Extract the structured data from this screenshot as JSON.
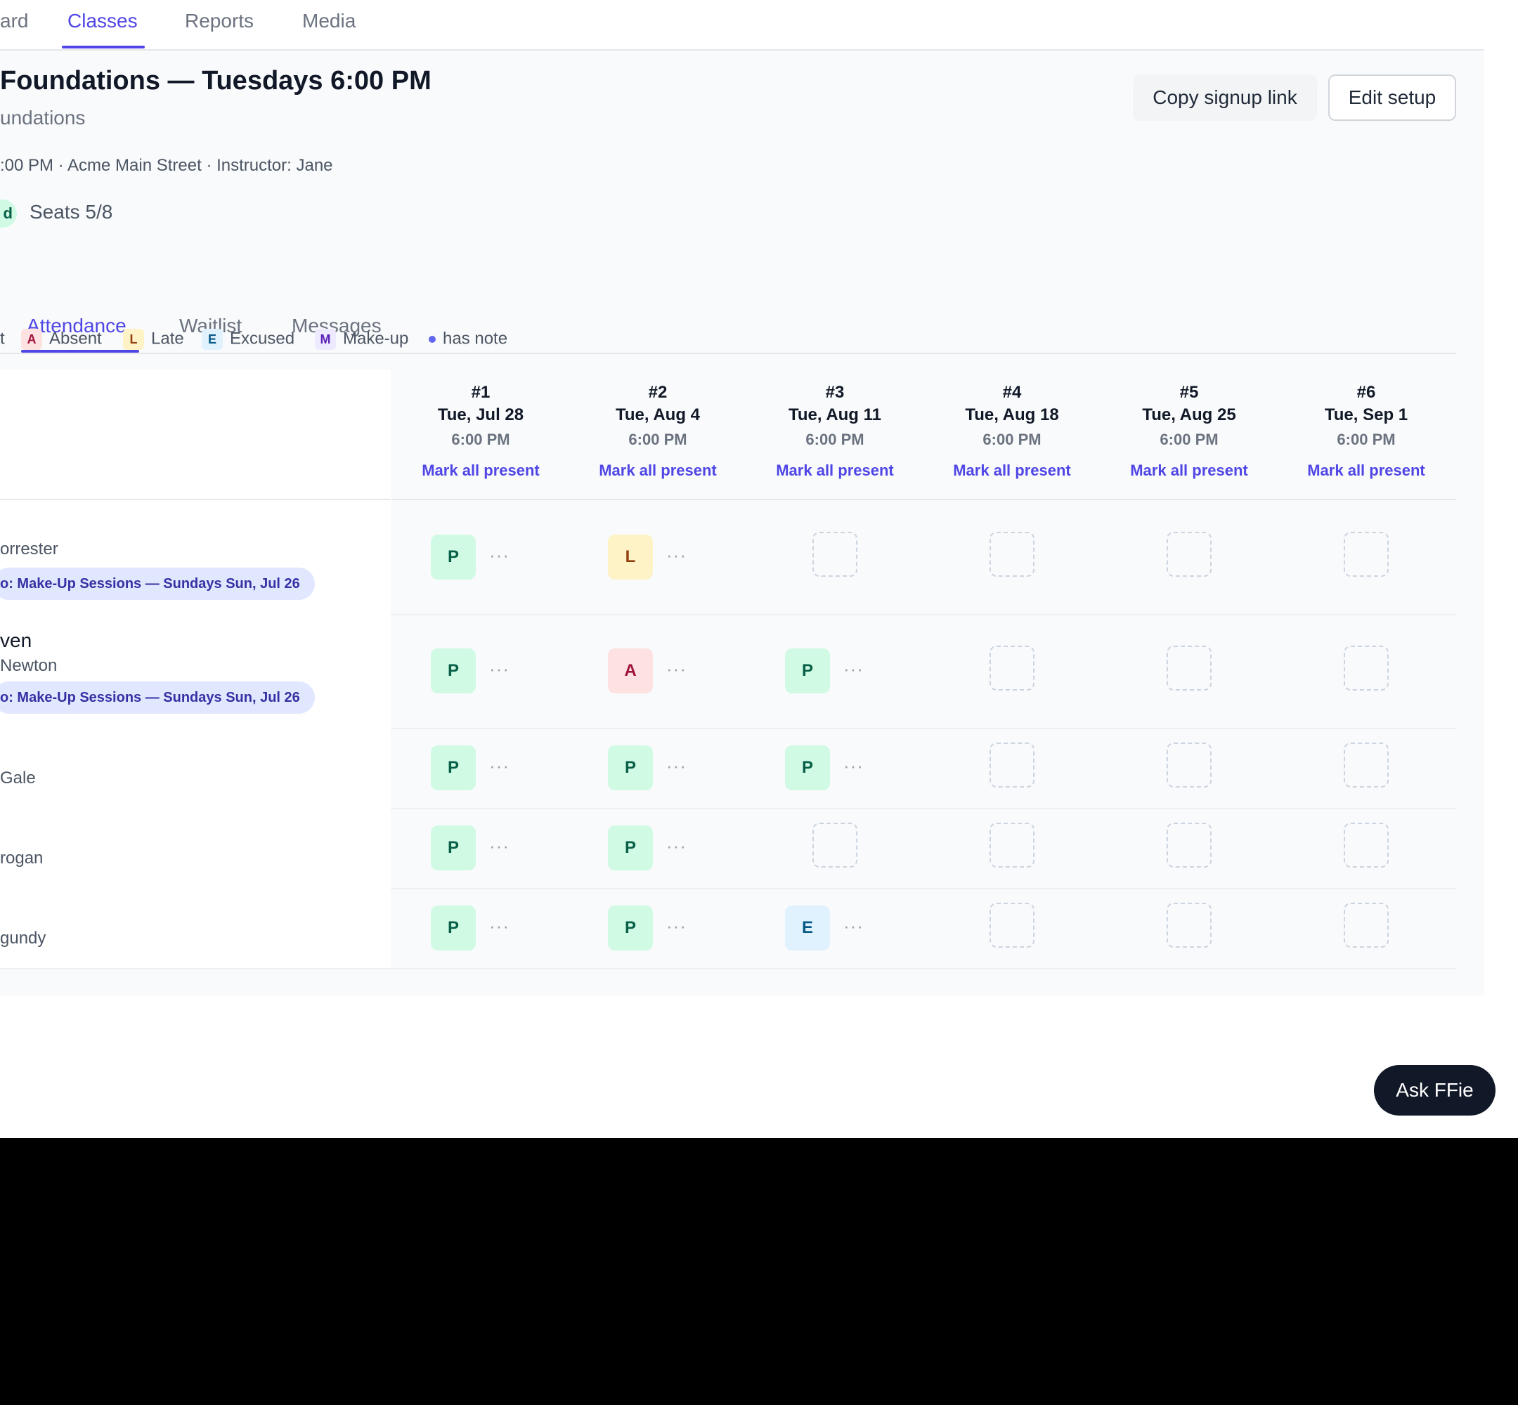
{
  "nav": {
    "items": [
      {
        "label": "ard",
        "active": false
      },
      {
        "label": "Classes",
        "active": true
      },
      {
        "label": "Reports",
        "active": false
      },
      {
        "label": "Media",
        "active": false
      }
    ]
  },
  "header": {
    "title": "Foundations — Tuesdays 6:00 PM",
    "subtitle": "undations",
    "meta": ":00 PM · Acme Main Street · Instructor: Jane",
    "status_badge": "d",
    "seats": "Seats 5/8",
    "copy_label": "Copy signup link",
    "edit_label": "Edit setup"
  },
  "tabs": [
    {
      "label": "Attendance",
      "active": true
    },
    {
      "label": "Waitlist",
      "active": false
    },
    {
      "label": "Messages",
      "active": false
    }
  ],
  "legend": {
    "partial_present": "t",
    "items": [
      {
        "code": "A",
        "label": "Absent"
      },
      {
        "code": "L",
        "label": "Late"
      },
      {
        "code": "E",
        "label": "Excused"
      },
      {
        "code": "M",
        "label": "Make-up"
      }
    ],
    "note": "has note"
  },
  "sessions": [
    {
      "num": "#1",
      "date": "Tue, Jul 28",
      "time": "6:00 PM",
      "action": "Mark all present"
    },
    {
      "num": "#2",
      "date": "Tue, Aug 4",
      "time": "6:00 PM",
      "action": "Mark all present"
    },
    {
      "num": "#3",
      "date": "Tue, Aug 11",
      "time": "6:00 PM",
      "action": "Mark all present"
    },
    {
      "num": "#4",
      "date": "Tue, Aug 18",
      "time": "6:00 PM",
      "action": "Mark all present"
    },
    {
      "num": "#5",
      "date": "Tue, Aug 25",
      "time": "6:00 PM",
      "action": "Mark all present"
    },
    {
      "num": "#6",
      "date": "Tue, Sep 1",
      "time": "6:00 PM",
      "action": "Mark all present"
    }
  ],
  "students": [
    {
      "name": "",
      "sub": "orrester",
      "makeup": "o: Make-Up Sessions — Sundays Sun, Jul 26",
      "marks": [
        "P",
        "L",
        "",
        "",
        "",
        ""
      ]
    },
    {
      "name": "ven",
      "sub": "Newton",
      "makeup": "o: Make-Up Sessions — Sundays Sun, Jul 26",
      "marks": [
        "P",
        "A",
        "P",
        "",
        "",
        ""
      ]
    },
    {
      "name": "",
      "sub": "Gale",
      "makeup": "",
      "marks": [
        "P",
        "P",
        "P",
        "",
        "",
        ""
      ]
    },
    {
      "name": "",
      "sub": "rogan",
      "makeup": "",
      "marks": [
        "P",
        "P",
        "",
        "",
        "",
        ""
      ]
    },
    {
      "name": "",
      "sub": "gundy",
      "makeup": "",
      "marks": [
        "P",
        "P",
        "E",
        "",
        "",
        ""
      ]
    }
  ],
  "more_glyph": "···",
  "assistant": {
    "label": "Ask FFie"
  },
  "colors": {
    "accent": "#4f46e5",
    "present": "#d1fae5",
    "late": "#fef3c7",
    "absent": "#fee2e2",
    "excused": "#e0f2fe",
    "makeup": "#ede9fe"
  }
}
